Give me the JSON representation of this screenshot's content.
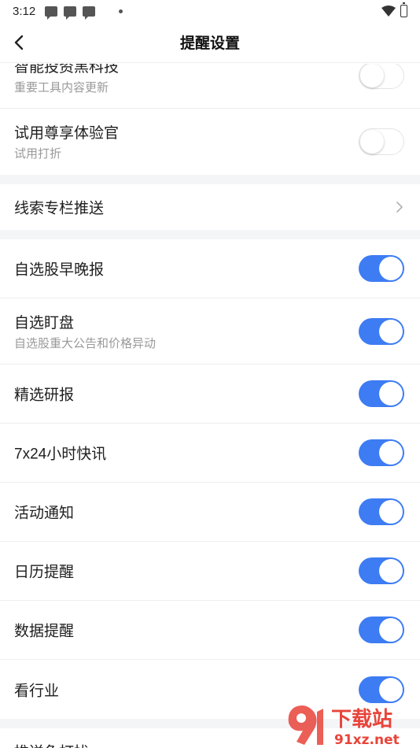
{
  "status_bar": {
    "time": "3:12"
  },
  "header": {
    "title": "提醒设置"
  },
  "section1": [
    {
      "label": "智能投资黑科技",
      "sub": "重要工具内容更新",
      "on": false
    },
    {
      "label": "试用尊享体验官",
      "sub": "试用打折",
      "on": false
    }
  ],
  "section2": {
    "label": "线索专栏推送"
  },
  "section3": [
    {
      "label": "自选股早晚报",
      "on": true
    },
    {
      "label": "自选盯盘",
      "sub": "自选股重大公告和价格异动",
      "on": true
    },
    {
      "label": "精选研报",
      "on": true
    },
    {
      "label": "7x24小时快讯",
      "on": true
    },
    {
      "label": "活动通知",
      "on": true
    },
    {
      "label": "日历提醒",
      "on": true
    },
    {
      "label": "数据提醒",
      "on": true
    },
    {
      "label": "看行业",
      "on": true
    }
  ],
  "section4": {
    "label": "推送免打扰"
  },
  "watermark": {
    "text": "下载站",
    "domain": "91xz.net"
  },
  "colors": {
    "accent": "#3d7cf3",
    "divider": "#eeeeee",
    "section_gap": "#f4f5f7"
  }
}
